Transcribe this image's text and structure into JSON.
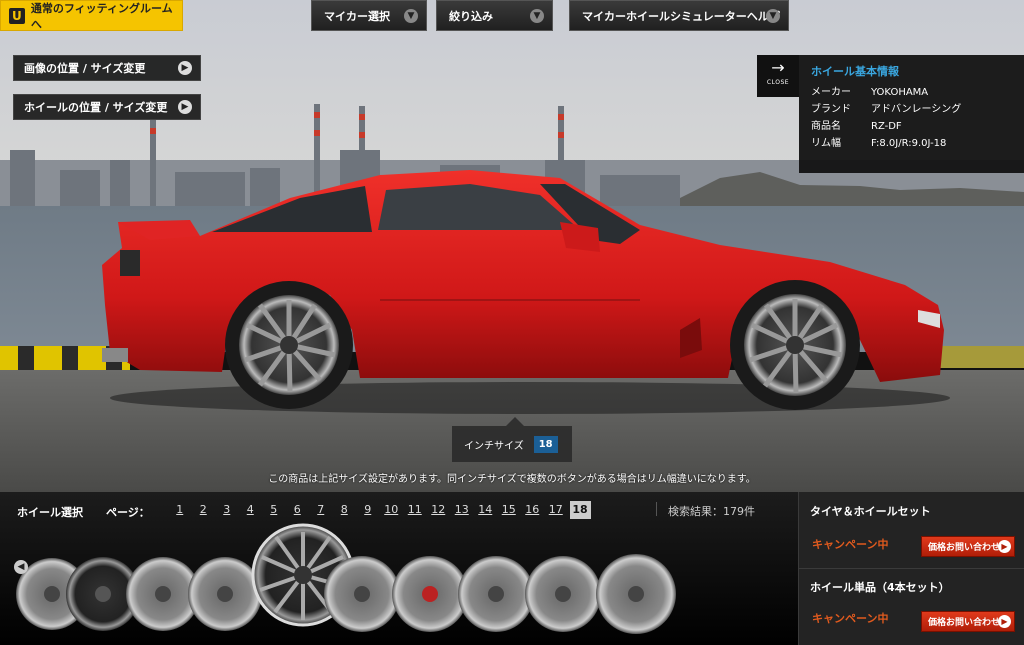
{
  "top": {
    "fitting_room_label": "通常のフィッティングルームへ",
    "fitting_room_icon": "u-icon",
    "my_car_label": "マイカー選択",
    "filter_label": "絞り込み",
    "help_label": "マイカーホイールシミュレーターヘルプ"
  },
  "side": {
    "image_pos_label": "画像の位置 / サイズ変更",
    "wheel_pos_label": "ホイールの位置 / サイズ変更"
  },
  "info": {
    "close_label": "CLOSE",
    "title": "ホイール基本情報",
    "rows": [
      {
        "key": "メーカー",
        "value": "YOKOHAMA"
      },
      {
        "key": "ブランド",
        "value": "アドバンレーシング"
      },
      {
        "key": "商品名",
        "value": "RZ-DF"
      },
      {
        "key": "リム幅",
        "value": "F:8.0J/R:9.0J-18"
      }
    ]
  },
  "inch": {
    "label": "インチサイズ",
    "value": "18"
  },
  "note": "この商品は上記サイズ設定があります。同インチサイズで複数のボタンがある場合はリム幅違いになります。",
  "bottom": {
    "wheel_select_label": "ホイール選択",
    "page_label": "ページ：",
    "pages": [
      "1",
      "2",
      "3",
      "4",
      "5",
      "6",
      "7",
      "8",
      "9",
      "10",
      "11",
      "12",
      "13",
      "14",
      "15",
      "16",
      "17",
      "18"
    ],
    "current_page": "18",
    "results": "検索結果：179件"
  },
  "price": {
    "set_title": "タイヤ＆ホイールセット",
    "set_campaign": "キャンペーン中",
    "set_button": "価格お問い合わせ",
    "single_title": "ホイール単品（4本セット）",
    "single_campaign": "キャンペーン中",
    "single_button": "価格お問い合わせ"
  },
  "colors": {
    "accent_yellow": "#f5c400",
    "info_title_blue": "#3aa7e0",
    "inch_badge_blue": "#1b5f96",
    "campaign_orange": "#e05a1e",
    "price_button_red": "#c82a12",
    "car_red": "#d81e1e"
  }
}
